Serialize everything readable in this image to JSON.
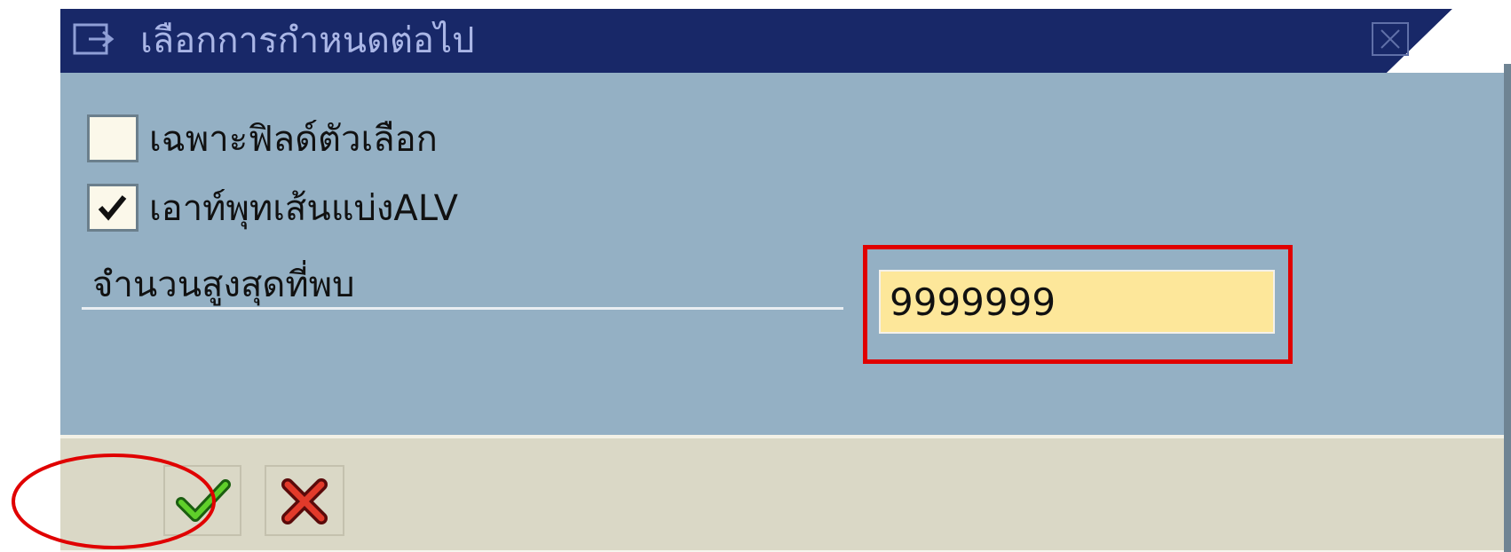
{
  "dialog": {
    "title": "เลือกการกำหนดต่อไป",
    "title_icon": "options-arrow-icon",
    "close_icon": "close-icon"
  },
  "options": {
    "selection_fields_only": {
      "label": "เฉพาะฟิลด์ตัวเลือก",
      "checked": false
    },
    "alv_grid_output": {
      "label": "เอาท์พุทเส้นแบ่งALV",
      "checked": true
    }
  },
  "max_hits": {
    "label": "จำนวนสูงสุดที่พบ",
    "value": "9999999"
  },
  "footer": {
    "ok_icon": "checkmark-icon",
    "cancel_icon": "cancel-x-icon"
  },
  "colors": {
    "titlebar": "#182868",
    "body": "#94b0c4",
    "footer": "#dad8c6",
    "input_bg": "#fde79a",
    "highlight": "#e00000"
  }
}
